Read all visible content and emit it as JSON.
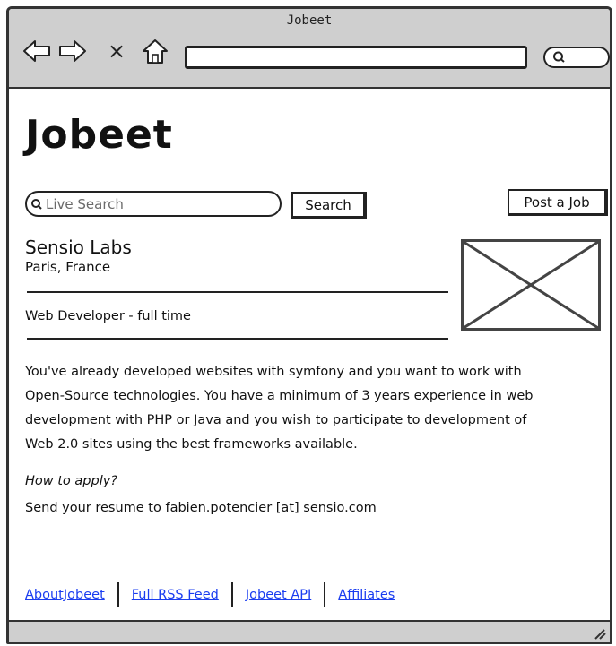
{
  "window": {
    "title": "Jobeet"
  },
  "browser": {
    "icons": [
      "back-arrow-icon",
      "forward-arrow-icon",
      "close-icon",
      "home-icon",
      "search-icon"
    ],
    "url": "",
    "stop_glyph": "×"
  },
  "header": {
    "logo_text": "Jobeet",
    "search_placeholder": "Live Search",
    "search_button": "Search",
    "post_button": "Post a Job"
  },
  "job": {
    "company": "Sensio Labs",
    "location": "Paris, France",
    "position": "Web Developer - full time",
    "description_lines": [
      "You've already developed websites with symfony and you want to work with",
      "Open-Source technologies. You have a minimum of 3 years experience in web",
      "development with PHP or Java and you wish to participate to development of",
      "Web 2.0 sites using the best frameworks available."
    ],
    "how_to_apply_label": "How to apply?",
    "how_to_apply_text": "Send your resume to fabien.potencier [at] sensio.com"
  },
  "footer": {
    "links": [
      "AboutJobeet",
      "Full RSS Feed",
      "Jobeet API",
      "Affiliates"
    ]
  },
  "colors": {
    "chrome": "#cfcfcf",
    "link": "#1a3df0",
    "border": "#222222"
  }
}
